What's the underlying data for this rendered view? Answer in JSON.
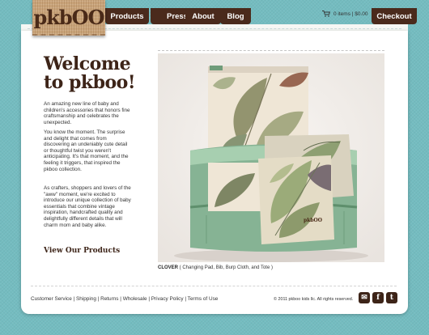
{
  "logo": {
    "text": "pkbOO"
  },
  "nav": [
    {
      "label": "Products"
    },
    {
      "label": "Press"
    },
    {
      "label": "About"
    },
    {
      "label": "Blog"
    }
  ],
  "cart": {
    "icon": "cart-icon",
    "text": "0 items  |  $0.00"
  },
  "checkout_label": "Checkout",
  "hero": {
    "title_line1": "Welcome",
    "title_line2": "to pkboo!"
  },
  "intro": {
    "p1": "An amazing new line of baby and children's accessories that honors fine craftsmanship and celebrates the unexpected.",
    "p2": "You know the moment. The surprise and delight that comes from discovering an undeniably cute detail or thoughtful twist you weren't anticipating. It's that moment, and the feeling it triggers, that inspired the pkboo collection.",
    "p3": "As crafters, shoppers and lovers of the \"aww\" moment, we're excited to introduce our unique collection of baby essentials that combine vintage inspiration, handcrafted quality and delightfully different details that will charm mom and baby alike.",
    "cta": "View Our Products"
  },
  "photo": {
    "caption_bold": "CLOVER",
    "caption_rest": " ( Changing Pad, Bib, Burp Cloth, and Tote )",
    "tag": "pkbOO"
  },
  "footer": {
    "links": [
      "Customer Service",
      "Shipping",
      "Returns",
      "Wholesale",
      "Privacy Policy",
      "Terms of Use"
    ],
    "copyright": "© 2011 pkboo kids llc. All rights reserved.",
    "social": [
      {
        "icon": "email-icon",
        "glyph": "✉"
      },
      {
        "icon": "facebook-icon",
        "glyph": "f"
      },
      {
        "icon": "twitter-icon",
        "glyph": "t"
      }
    ]
  }
}
